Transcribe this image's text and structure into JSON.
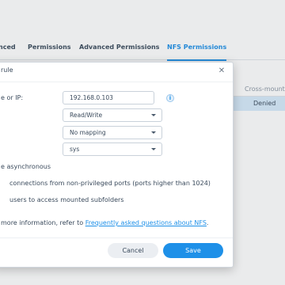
{
  "tabs": [
    {
      "label": "nced"
    },
    {
      "label": "Permissions"
    },
    {
      "label": "Advanced Permissions"
    },
    {
      "label": "NFS Permissions",
      "active": true
    }
  ],
  "table": {
    "header": "Cross-mount",
    "row_value": "Denied"
  },
  "dialog": {
    "title": "rule",
    "close_icon": "close-icon",
    "fields": {
      "host_label": "e or IP:",
      "host_value": "192.168.0.103",
      "privilege_value": "Read/Write",
      "squash_value": "No mapping",
      "security_value": "sys"
    },
    "options": {
      "async_label": "e asynchronous",
      "ports_label": "connections from non-privileged ports (ports higher than 1024)",
      "subfolders_label": "users to access mounted subfolders"
    },
    "help": {
      "prefix": "more information, refer to ",
      "link": "Frequently asked questions about NFS",
      "suffix": "."
    },
    "buttons": {
      "cancel": "Cancel",
      "save": "Save"
    }
  },
  "colors": {
    "accent": "#1e90e8",
    "selected_row": "#d6ebfb"
  }
}
